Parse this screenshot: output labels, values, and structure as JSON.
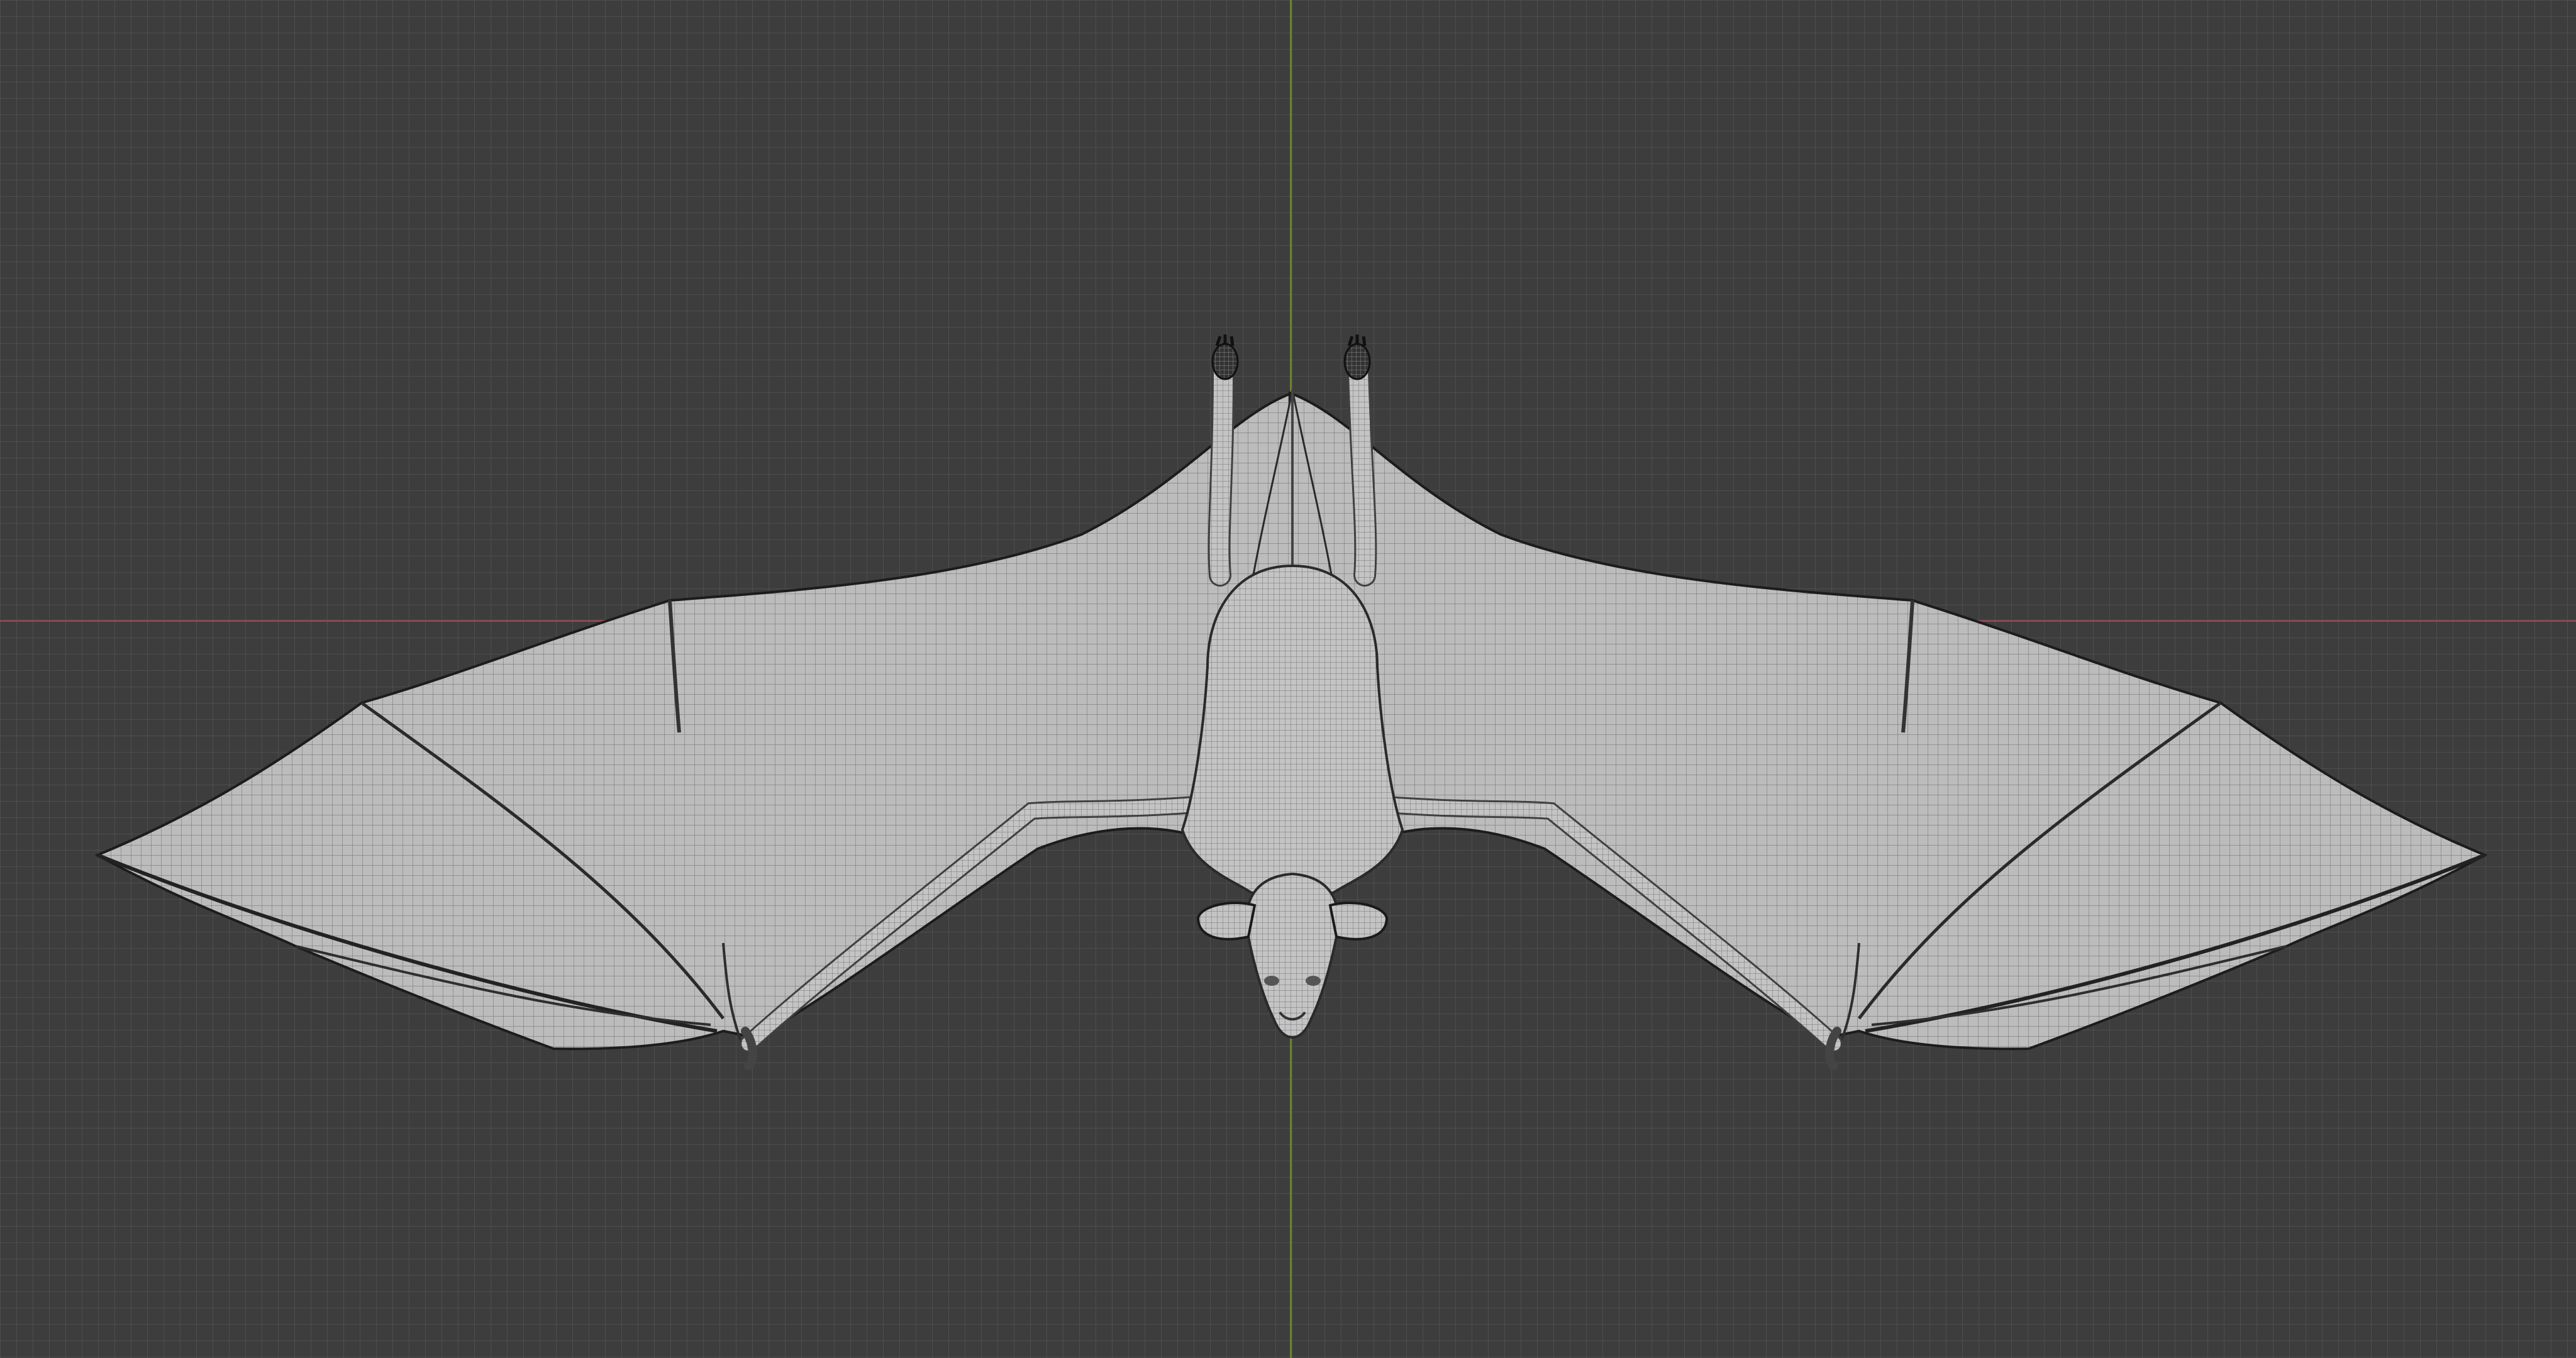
{
  "viewport": {
    "name": "3D Viewport",
    "background_color": "#3d3d3d",
    "grid_color": "#505050",
    "x_axis_color": "#8a4a53",
    "y_axis_color": "#6a8030"
  },
  "model": {
    "name": "bat",
    "display": "wireframe-on-solid",
    "surface_color": "#b9b9b9",
    "wire_color": "#6e6e6e"
  }
}
